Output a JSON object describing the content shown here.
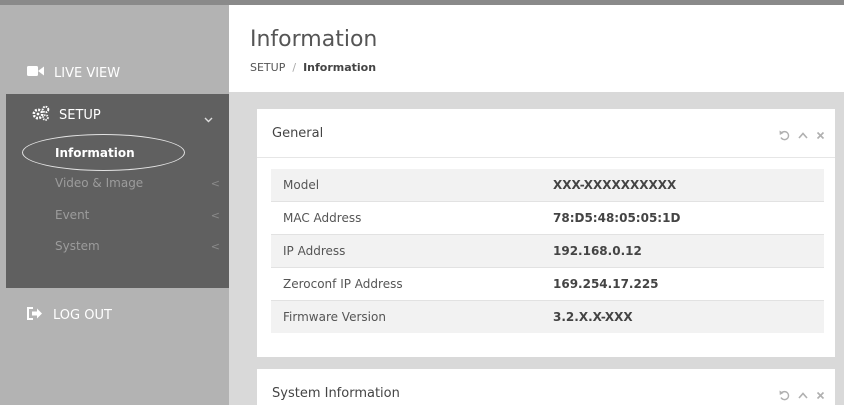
{
  "sidebar": {
    "live_view_label": "LIVE VIEW",
    "setup_label": "SETUP",
    "setup_items": [
      {
        "label": "Information",
        "active": true
      },
      {
        "label": "Video & Image",
        "caret": "<"
      },
      {
        "label": "Event",
        "caret": "<"
      },
      {
        "label": "System",
        "caret": "<"
      }
    ],
    "logout_label": "LOG OUT"
  },
  "header": {
    "title": "Information",
    "breadcrumb": {
      "root": "SETUP",
      "separator": "/",
      "current": "Information"
    }
  },
  "panels": {
    "general": {
      "title": "General",
      "rows": [
        {
          "label": "Model",
          "value": "XXX-XXXXXXXXXX"
        },
        {
          "label": "MAC Address",
          "value": "78:D5:48:05:05:1D"
        },
        {
          "label": "IP Address",
          "value": "192.168.0.12"
        },
        {
          "label": "Zeroconf IP Address",
          "value": "169.254.17.225"
        },
        {
          "label": "Firmware Version",
          "value": "3.2.X.X-XXX"
        }
      ]
    },
    "system_information": {
      "title": "System Information"
    }
  },
  "icons": {
    "live_view": "video-camera-icon",
    "setup": "gears-icon",
    "logout": "sign-out-icon",
    "panel_tools": [
      "refresh-icon",
      "collapse-icon",
      "close-icon"
    ]
  },
  "colors": {
    "sidebar_bg": "#b3b3b3",
    "setup_block_bg": "#606060",
    "main_bg": "#d9d9d9",
    "row_stripe": "#f2f2f2"
  }
}
